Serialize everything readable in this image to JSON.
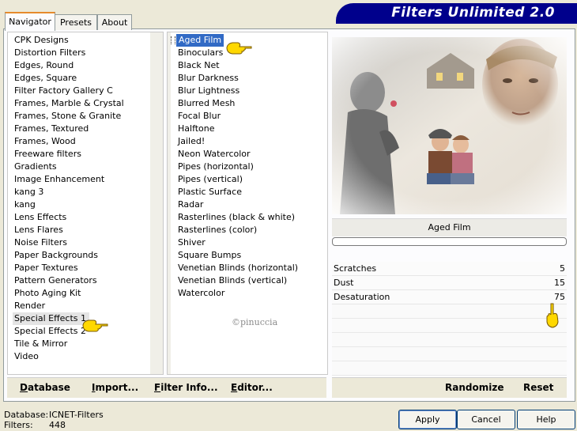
{
  "tabs": [
    "Navigator",
    "Presets",
    "About"
  ],
  "banner": {
    "title": "Filters Unlimited 2.0"
  },
  "categories": [
    "CPK Designs",
    "Distortion Filters",
    "Edges, Round",
    "Edges, Square",
    "Filter Factory Gallery C",
    "Frames, Marble & Crystal",
    "Frames, Stone & Granite",
    "Frames, Textured",
    "Frames, Wood",
    "Freeware filters",
    "Gradients",
    "Image Enhancement",
    "kang 3",
    "kang",
    "Lens Effects",
    "Lens Flares",
    "Noise Filters",
    "Paper Backgrounds",
    "Paper Textures",
    "Pattern Generators",
    "Photo Aging Kit",
    "Render",
    "Special Effects 1",
    "Special Effects 2",
    "Tile & Mirror",
    "Video"
  ],
  "filters": [
    "Aged Film",
    "Binoculars",
    "Black Net",
    "Blur Darkness",
    "Blur Lightness",
    "Blurred Mesh",
    "Focal Blur",
    "Halftone",
    "Jailed!",
    "Neon Watercolor",
    "Pipes (horizontal)",
    "Pipes (vertical)",
    "Plastic Surface",
    "Radar",
    "Rasterlines (black & white)",
    "Rasterlines (color)",
    "Shiver",
    "Square Bumps",
    "Venetian Blinds (horizontal)",
    "Venetian Blinds (vertical)",
    "Watercolor"
  ],
  "selected_category": "Special Effects 1",
  "selected_filter": "Aged Film",
  "preview": {
    "filter_name": "Aged Film",
    "watermark": "©pinuccia"
  },
  "params": [
    {
      "label": "Scratches",
      "value": "5"
    },
    {
      "label": "Dust",
      "value": "15"
    },
    {
      "label": "Desaturation",
      "value": "75"
    }
  ],
  "toolbar_left": {
    "database": "Database",
    "import": "Import...",
    "filter_info": "Filter Info...",
    "editor": "Editor..."
  },
  "toolbar_right": {
    "randomize": "Randomize",
    "reset": "Reset"
  },
  "status": {
    "database_label": "Database:",
    "database_value": "ICNET-Filters",
    "filters_label": "Filters:",
    "filters_value": "448"
  },
  "buttons": {
    "apply": "Apply",
    "cancel": "Cancel",
    "help": "Help"
  },
  "colors": {
    "banner": "#00008c",
    "selection": "#316ac5",
    "tab_accent": "#e68b2c",
    "pointer_hand": "#ffd800"
  }
}
